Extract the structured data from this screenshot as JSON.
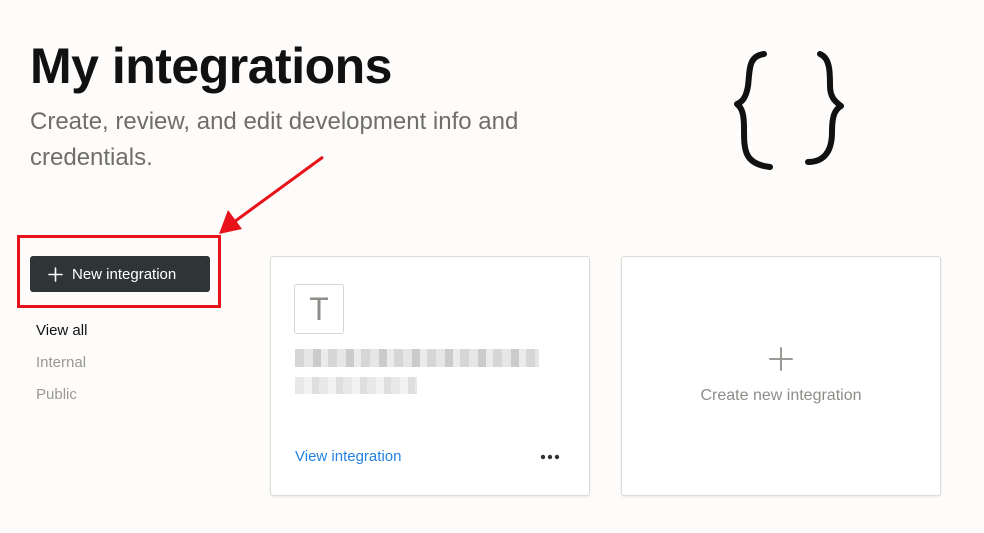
{
  "header": {
    "title": "My integrations",
    "subtitle": "Create, review, and edit development info and credentials."
  },
  "logo": {
    "icon": "curly-braces-icon"
  },
  "new_button": {
    "label": "New integration",
    "icon": "plus-icon"
  },
  "filters": [
    {
      "label": "View all",
      "active": true
    },
    {
      "label": "Internal",
      "active": false
    },
    {
      "label": "Public",
      "active": false
    }
  ],
  "integration_card": {
    "avatar_letter": "T",
    "view_link": "View integration",
    "more_icon": "more-horizontal-icon"
  },
  "create_card": {
    "label": "Create new integration",
    "icon": "plus-icon"
  },
  "annotation": {
    "color": "#e8131a"
  },
  "colors": {
    "button_bg": "#2f3437",
    "link": "#2383e2",
    "title": "#111111",
    "muted": "#9a9996"
  }
}
